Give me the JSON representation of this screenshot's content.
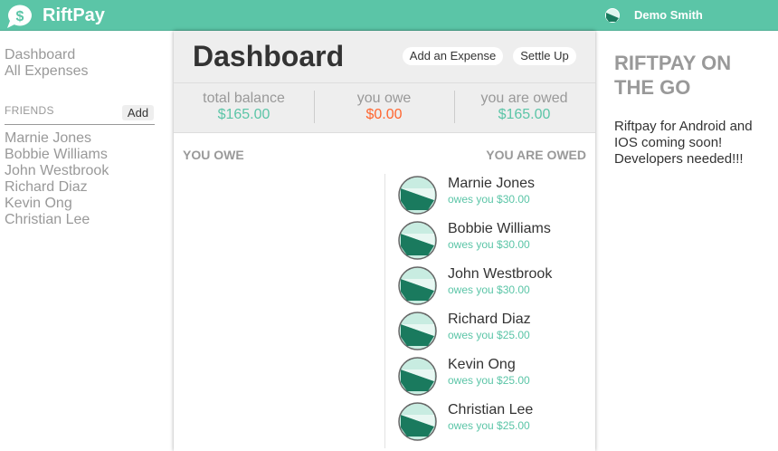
{
  "app": {
    "title": "RiftPay",
    "icon": "dollar-speech-bubble-icon"
  },
  "user": {
    "name": "Demo Smith",
    "avatar_icon": "user-avatar-icon"
  },
  "colors": {
    "brand": "#5bc5a7",
    "positive": "#5bc5a7",
    "negative": "#ff652f",
    "muted": "#999999",
    "text": "#333333"
  },
  "sidebar": {
    "nav": [
      {
        "label": "Dashboard"
      },
      {
        "label": "All Expenses"
      }
    ],
    "friends_label": "FRIENDS",
    "add_label": "Add",
    "friends": [
      "Marnie Jones",
      "Bobbie Williams",
      "John Westbrook",
      "Richard Diaz",
      "Kevin Ong",
      "Christian Lee"
    ]
  },
  "main": {
    "title": "Dashboard",
    "add_expense_label": "Add an Expense",
    "settle_up_label": "Settle Up",
    "balances": [
      {
        "label": "total balance",
        "value": "$165.00"
      },
      {
        "label": "you owe",
        "value": "$0.00"
      },
      {
        "label": "you are owed",
        "value": "$165.00"
      }
    ],
    "you_owe_title": "YOU OWE",
    "you_are_owed_title": "YOU ARE OWED",
    "owed": [
      {
        "name": "Marnie Jones",
        "amount": "owes you $30.00"
      },
      {
        "name": "Bobbie Williams",
        "amount": "owes you $30.00"
      },
      {
        "name": "John Westbrook",
        "amount": "owes you $30.00"
      },
      {
        "name": "Richard Diaz",
        "amount": "owes you $25.00"
      },
      {
        "name": "Kevin Ong",
        "amount": "owes you $25.00"
      },
      {
        "name": "Christian Lee",
        "amount": "owes you $25.00"
      }
    ]
  },
  "promo": {
    "title": "RIFTPAY ON THE GO",
    "text": "Riftpay for Android and IOS coming soon! Developers needed!!!"
  }
}
